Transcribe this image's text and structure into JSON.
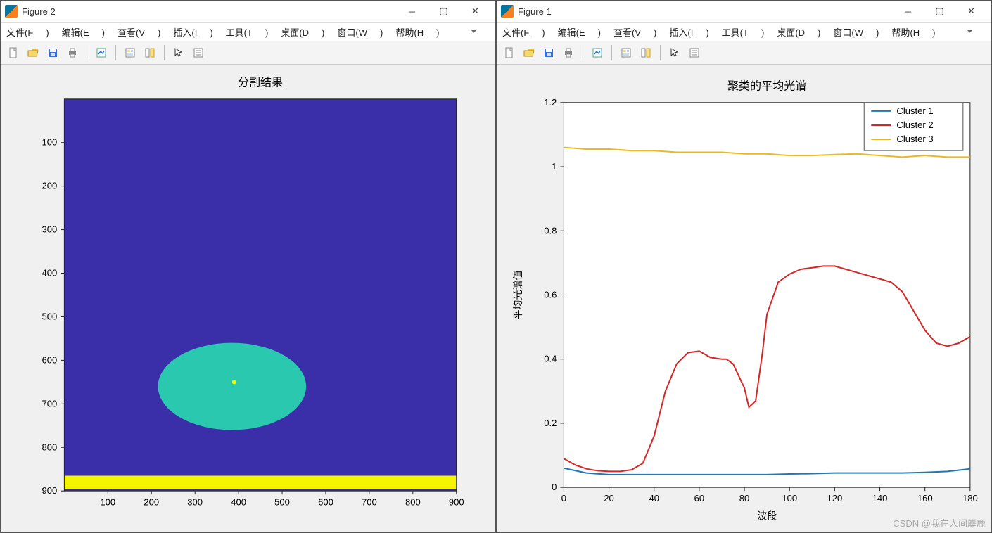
{
  "watermark": "CSDN @我在人间麋鹿",
  "window_left": {
    "title": "Figure 2",
    "menus": [
      "文件(F)",
      "编辑(E)",
      "查看(V)",
      "插入(I)",
      "工具(T)",
      "桌面(D)",
      "窗口(W)",
      "帮助(H)"
    ]
  },
  "window_right": {
    "title": "Figure 1",
    "menus": [
      "文件(F)",
      "编辑(E)",
      "查看(V)",
      "插入(I)",
      "工具(T)",
      "桌面(D)",
      "窗口(W)",
      "帮助(H)"
    ]
  },
  "toolbar_icons": [
    "new",
    "open",
    "save",
    "print",
    "|",
    "print-figure",
    "|",
    "data-cursor",
    "link",
    "|",
    "pointer",
    "edit-plot"
  ],
  "chart_data": [
    {
      "id": "segmentation",
      "type": "heatmap",
      "title": "分割结果",
      "xlim": [
        0,
        900
      ],
      "ylim": [
        900,
        0
      ],
      "xticks": [
        100,
        200,
        300,
        400,
        500,
        600,
        700,
        800,
        900
      ],
      "yticks": [
        100,
        200,
        300,
        400,
        500,
        600,
        700,
        800,
        900
      ],
      "regions": {
        "background": {
          "color": "#3a2fa8",
          "description": "full image fill"
        },
        "blob": {
          "color": "#2bc8b0",
          "shape": "ellipse",
          "cx": 385,
          "cy": 660,
          "rx": 170,
          "ry": 100
        },
        "strip": {
          "color": "#f5f500",
          "y_range": [
            865,
            895
          ]
        },
        "speck": {
          "color": "#f5f500",
          "shape": "dot",
          "cx": 390,
          "cy": 650,
          "r": 3
        }
      }
    },
    {
      "id": "spectra",
      "type": "line",
      "title": "聚类的平均光谱",
      "xlabel": "波段",
      "ylabel": "平均光谱值",
      "xlim": [
        0,
        180
      ],
      "ylim": [
        0,
        1.2
      ],
      "xticks": [
        0,
        20,
        40,
        60,
        80,
        100,
        120,
        140,
        160,
        180
      ],
      "yticks": [
        0,
        0.2,
        0.4,
        0.6,
        0.8,
        1,
        1.2
      ],
      "legend": [
        "Cluster 1",
        "Cluster 2",
        "Cluster 3"
      ],
      "series": [
        {
          "name": "Cluster 1",
          "color": "#1f77b4",
          "x": [
            0,
            10,
            20,
            30,
            40,
            50,
            60,
            70,
            80,
            90,
            100,
            110,
            120,
            130,
            140,
            150,
            160,
            170,
            180
          ],
          "y": [
            0.06,
            0.045,
            0.04,
            0.04,
            0.04,
            0.04,
            0.04,
            0.04,
            0.04,
            0.04,
            0.042,
            0.043,
            0.045,
            0.045,
            0.045,
            0.045,
            0.047,
            0.05,
            0.058
          ]
        },
        {
          "name": "Cluster 2",
          "color": "#d62728",
          "x": [
            0,
            5,
            10,
            15,
            20,
            25,
            30,
            35,
            40,
            45,
            50,
            55,
            60,
            65,
            70,
            72,
            75,
            80,
            82,
            85,
            88,
            90,
            95,
            100,
            105,
            110,
            115,
            120,
            125,
            130,
            135,
            140,
            145,
            150,
            155,
            160,
            165,
            170,
            175,
            180
          ],
          "y": [
            0.09,
            0.07,
            0.058,
            0.052,
            0.05,
            0.05,
            0.055,
            0.075,
            0.16,
            0.3,
            0.385,
            0.42,
            0.425,
            0.405,
            0.4,
            0.4,
            0.385,
            0.31,
            0.25,
            0.27,
            0.42,
            0.54,
            0.64,
            0.665,
            0.68,
            0.685,
            0.69,
            0.69,
            0.68,
            0.67,
            0.66,
            0.65,
            0.64,
            0.61,
            0.55,
            0.49,
            0.45,
            0.44,
            0.45,
            0.47
          ]
        },
        {
          "name": "Cluster 3",
          "color": "#e8b923",
          "x": [
            0,
            10,
            20,
            30,
            40,
            50,
            60,
            70,
            80,
            90,
            100,
            110,
            120,
            130,
            140,
            150,
            160,
            170,
            180
          ],
          "y": [
            1.06,
            1.055,
            1.055,
            1.05,
            1.05,
            1.045,
            1.045,
            1.045,
            1.04,
            1.04,
            1.035,
            1.035,
            1.038,
            1.04,
            1.035,
            1.03,
            1.035,
            1.03,
            1.03
          ]
        }
      ]
    }
  ]
}
